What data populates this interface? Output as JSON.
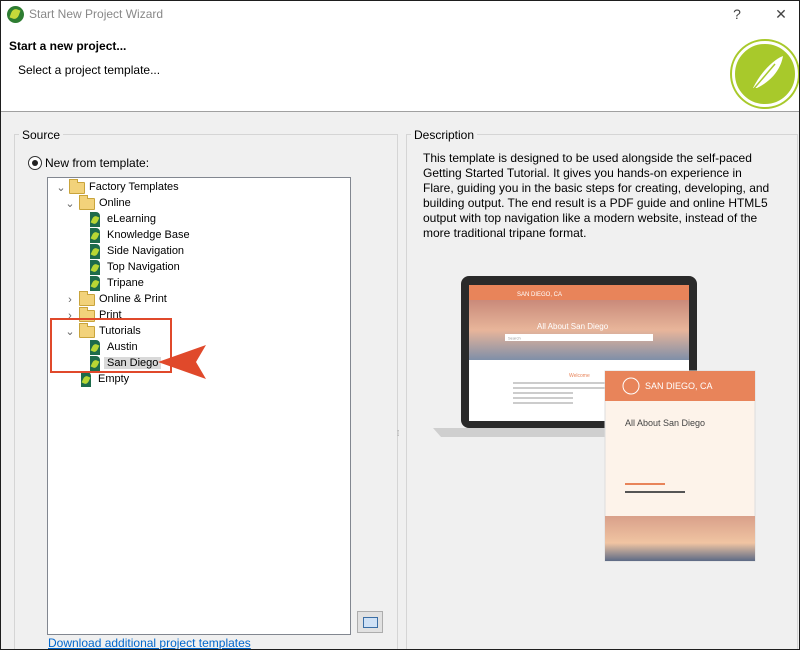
{
  "window": {
    "title": "Start New Project Wizard",
    "help_label": "?",
    "close_label": "✕"
  },
  "header": {
    "title": "Start a new project...",
    "subtitle": "Select a project template..."
  },
  "source": {
    "group_label": "Source",
    "radio_label": "New from template:",
    "tree": [
      {
        "label": "Factory Templates",
        "kind": "folder",
        "expanded": true
      },
      {
        "label": "Online",
        "kind": "folder",
        "expanded": true
      },
      {
        "label": "eLearning",
        "kind": "template"
      },
      {
        "label": "Knowledge Base",
        "kind": "template"
      },
      {
        "label": "Side Navigation",
        "kind": "template"
      },
      {
        "label": "Top Navigation",
        "kind": "template"
      },
      {
        "label": "Tripane",
        "kind": "template"
      },
      {
        "label": "Online & Print",
        "kind": "folder",
        "expanded": false
      },
      {
        "label": "Print",
        "kind": "folder",
        "expanded": false
      },
      {
        "label": "Tutorials",
        "kind": "folder",
        "expanded": true
      },
      {
        "label": "Austin",
        "kind": "template"
      },
      {
        "label": "San Diego",
        "kind": "template",
        "selected": true
      },
      {
        "label": "Empty",
        "kind": "template"
      }
    ],
    "download_link": "Download additional project templates"
  },
  "description": {
    "group_label": "Description",
    "text": "This template is designed to be used alongside the self-paced Getting Started Tutorial. It gives you hands-on experience in Flare, guiding you in the basic steps for creating, developing, and building output. The end result is a PDF guide and online HTML5 output with top navigation like a modern website, instead of the more traditional tripane format.",
    "preview": {
      "laptop_site_title": "SAN DIEGO, CA",
      "laptop_heading": "All About San Diego",
      "laptop_search_placeholder": "Search",
      "laptop_welcome": "Welcome",
      "pdf_header": "SAN DIEGO, CA",
      "pdf_title": "All About San Diego"
    }
  },
  "colors": {
    "accent_orange": "#e8845a",
    "annotation_red": "#e0492b",
    "flare_green": "#a8c92b",
    "link_blue": "#0066cc"
  }
}
